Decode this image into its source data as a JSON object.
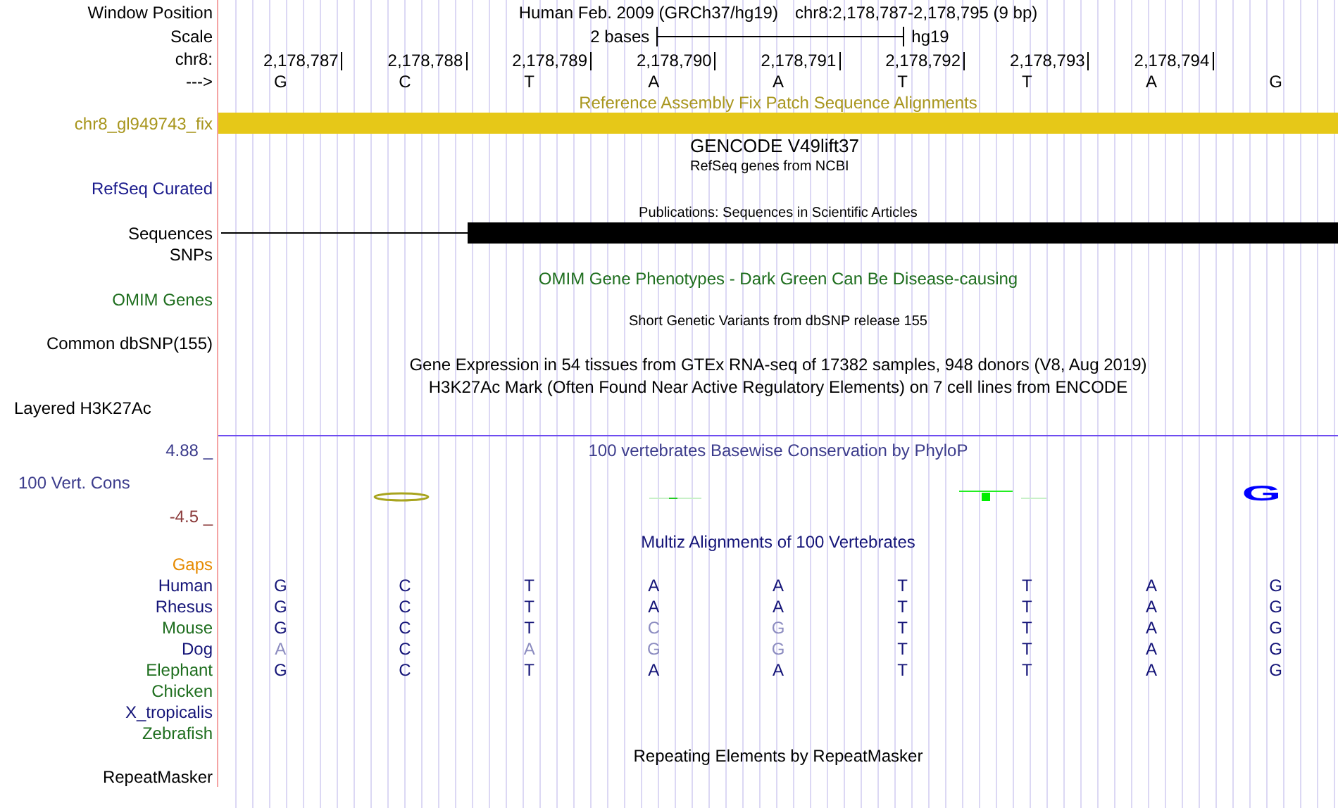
{
  "header": {
    "label": "Window Position",
    "assembly": "Human Feb. 2009 (GRCh37/hg19)",
    "position": "chr8:2,178,787-2,178,795 (9 bp)"
  },
  "scale": {
    "label": "Scale",
    "text": "2 bases",
    "assembly": "hg19"
  },
  "ruler": {
    "label": "chr8:",
    "ticks": [
      "2,178,787",
      "2,178,788",
      "2,178,789",
      "2,178,790",
      "2,178,791",
      "2,178,792",
      "2,178,793",
      "2,178,794"
    ]
  },
  "bases": {
    "label": "--->",
    "letters": [
      "G",
      "C",
      "T",
      "A",
      "A",
      "T",
      "T",
      "A",
      "G"
    ]
  },
  "tracks": [
    {
      "kind": "fix",
      "title": "Reference Assembly Fix Patch Sequence Alignments",
      "label": "chr8_gl949743_fix"
    },
    {
      "kind": "genes",
      "title": "GENCODE V49lift37",
      "subtitle": "RefSeq genes from NCBI",
      "label": "RefSeq Curated"
    },
    {
      "kind": "pubs",
      "title": "Publications: Sequences in Scientific Articles",
      "label": "Sequences",
      "label_2": "SNPs"
    },
    {
      "kind": "plain",
      "title": "OMIM Gene Phenotypes - Dark Green Can Be Disease-causing",
      "label": "OMIM Genes",
      "color": "#1e6e1e"
    },
    {
      "kind": "small",
      "title": "Short Genetic Variants from dbSNP release 155",
      "label": "Common dbSNP(155)",
      "color": "#000000"
    },
    {
      "kind": "double",
      "title": "Gene Expression in 54 tissues from GTEx RNA-seq of 17382 samples, 948 donors (V8, Aug 2019)",
      "subtitle": "H3K27Ac Mark (Often Found Near Active Regulatory Elements) on 7 cell lines from ENCODE",
      "label": "Layered H3K27Ac"
    },
    {
      "kind": "conservation",
      "title": "100 vertebrates Basewise Conservation by PhyloP",
      "label": "100 Vert. Cons",
      "max": "4.88 _",
      "min": "-4.5 _",
      "logo_letter": "G"
    },
    {
      "kind": "multiz",
      "title": "Multiz Alignments of 100 Vertebrates",
      "gaps_label": "Gaps",
      "species": [
        {
          "name": "Human",
          "color": "#141478",
          "bases": [
            "G",
            "C",
            "T",
            "A",
            "A",
            "T",
            "T",
            "A",
            "G"
          ],
          "faded": [
            false,
            false,
            false,
            false,
            false,
            false,
            false,
            false,
            false
          ]
        },
        {
          "name": "Rhesus",
          "color": "#141478",
          "bases": [
            "G",
            "C",
            "T",
            "A",
            "A",
            "T",
            "T",
            "A",
            "G"
          ],
          "faded": [
            false,
            false,
            false,
            false,
            false,
            false,
            false,
            false,
            false
          ]
        },
        {
          "name": "Mouse",
          "color": "#1e6e1e",
          "bases": [
            "G",
            "C",
            "T",
            "C",
            "G",
            "T",
            "T",
            "A",
            "G"
          ],
          "faded": [
            false,
            false,
            false,
            true,
            true,
            false,
            false,
            false,
            false
          ]
        },
        {
          "name": "Dog",
          "color": "#141478",
          "bases": [
            "A",
            "C",
            "A",
            "G",
            "G",
            "T",
            "T",
            "A",
            "G"
          ],
          "faded": [
            true,
            false,
            true,
            true,
            true,
            false,
            false,
            false,
            false
          ]
        },
        {
          "name": "Elephant",
          "color": "#1e6e1e",
          "bases": [
            "G",
            "C",
            "T",
            "A",
            "A",
            "T",
            "T",
            "A",
            "G"
          ],
          "faded": [
            false,
            false,
            false,
            false,
            false,
            false,
            false,
            false,
            false
          ]
        },
        {
          "name": "Chicken",
          "color": "#1e6e1e"
        },
        {
          "name": "X_tropicalis",
          "color": "#141478"
        },
        {
          "name": "Zebrafish",
          "color": "#1e6e1e"
        }
      ]
    },
    {
      "kind": "plain",
      "title": "Repeating Elements by RepeatMasker",
      "label": "RepeatMasker",
      "color": "#000000"
    }
  ]
}
